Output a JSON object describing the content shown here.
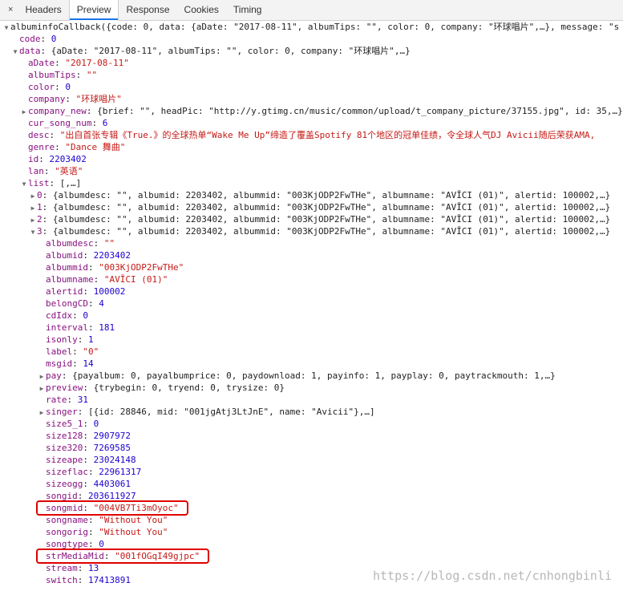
{
  "tabs": {
    "close": "×",
    "items": [
      "Headers",
      "Preview",
      "Response",
      "Cookies",
      "Timing"
    ],
    "active": "Preview"
  },
  "tree": [
    {
      "indent": 0,
      "t": "open",
      "k": "albuminfoCallback",
      "sep": "(",
      "v": "{code: 0, data: {aDate: \"2017-08-11\", albumTips: \"\", color: 0, company: \"环球唱片\",…}, message: \"s",
      "ty": "plain"
    },
    {
      "indent": 1,
      "t": "leaf",
      "k": "code",
      "sep": ": ",
      "v": "0",
      "ty": "num"
    },
    {
      "indent": 1,
      "t": "open",
      "k": "data",
      "sep": ": ",
      "v": "{aDate: \"2017-08-11\", albumTips: \"\", color: 0, company: \"环球唱片\",…}",
      "ty": "plain"
    },
    {
      "indent": 2,
      "t": "leaf",
      "k": "aDate",
      "sep": ": ",
      "v": "\"2017-08-11\"",
      "ty": "str"
    },
    {
      "indent": 2,
      "t": "leaf",
      "k": "albumTips",
      "sep": ": ",
      "v": "\"\"",
      "ty": "str"
    },
    {
      "indent": 2,
      "t": "leaf",
      "k": "color",
      "sep": ": ",
      "v": "0",
      "ty": "num"
    },
    {
      "indent": 2,
      "t": "leaf",
      "k": "company",
      "sep": ": ",
      "v": "\"环球唱片\"",
      "ty": "str"
    },
    {
      "indent": 2,
      "t": "closed",
      "k": "company_new",
      "sep": ": ",
      "v": "{brief: \"\", headPic: \"http://y.gtimg.cn/music/common/upload/t_company_picture/37155.jpg\", id: 35,…}",
      "ty": "plain"
    },
    {
      "indent": 2,
      "t": "leaf",
      "k": "cur_song_num",
      "sep": ": ",
      "v": "6",
      "ty": "num"
    },
    {
      "indent": 2,
      "t": "leaf",
      "k": "desc",
      "sep": ": ",
      "v": "\"出自首张专辑《True.》的全球热单“Wake Me Up”缔造了覆盖Spotify 81个地区的冠单佳绩，令全球人气DJ Avicii随后荣获AMA,",
      "ty": "str"
    },
    {
      "indent": 2,
      "t": "leaf",
      "k": "genre",
      "sep": ": ",
      "v": "\"Dance 舞曲\"",
      "ty": "str"
    },
    {
      "indent": 2,
      "t": "leaf",
      "k": "id",
      "sep": ": ",
      "v": "2203402",
      "ty": "num"
    },
    {
      "indent": 2,
      "t": "leaf",
      "k": "lan",
      "sep": ": ",
      "v": "\"英语\"",
      "ty": "str"
    },
    {
      "indent": 2,
      "t": "open",
      "k": "list",
      "sep": ": ",
      "v": "[,…]",
      "ty": "plain"
    },
    {
      "indent": 3,
      "t": "closed",
      "k": "0",
      "sep": ": ",
      "v": "{albumdesc: \"\", albumid: 2203402, albummid: \"003KjODP2FwTHe\", albumname: \"AVĪCI (01)\", alertid: 100002,…}",
      "ty": "plain"
    },
    {
      "indent": 3,
      "t": "closed",
      "k": "1",
      "sep": ": ",
      "v": "{albumdesc: \"\", albumid: 2203402, albummid: \"003KjODP2FwTHe\", albumname: \"AVĪCI (01)\", alertid: 100002,…}",
      "ty": "plain"
    },
    {
      "indent": 3,
      "t": "closed",
      "k": "2",
      "sep": ": ",
      "v": "{albumdesc: \"\", albumid: 2203402, albummid: \"003KjODP2FwTHe\", albumname: \"AVĪCI (01)\", alertid: 100002,…}",
      "ty": "plain"
    },
    {
      "indent": 3,
      "t": "open",
      "k": "3",
      "sep": ": ",
      "v": "{albumdesc: \"\", albumid: 2203402, albummid: \"003KjODP2FwTHe\", albumname: \"AVĪCI (01)\", alertid: 100002,…}",
      "ty": "plain"
    },
    {
      "indent": 4,
      "t": "leaf",
      "k": "albumdesc",
      "sep": ": ",
      "v": "\"\"",
      "ty": "str"
    },
    {
      "indent": 4,
      "t": "leaf",
      "k": "albumid",
      "sep": ": ",
      "v": "2203402",
      "ty": "num"
    },
    {
      "indent": 4,
      "t": "leaf",
      "k": "albummid",
      "sep": ": ",
      "v": "\"003KjODP2FwTHe\"",
      "ty": "str"
    },
    {
      "indent": 4,
      "t": "leaf",
      "k": "albumname",
      "sep": ": ",
      "v": "\"AVĪCI (01)\"",
      "ty": "str"
    },
    {
      "indent": 4,
      "t": "leaf",
      "k": "alertid",
      "sep": ": ",
      "v": "100002",
      "ty": "num"
    },
    {
      "indent": 4,
      "t": "leaf",
      "k": "belongCD",
      "sep": ": ",
      "v": "4",
      "ty": "num"
    },
    {
      "indent": 4,
      "t": "leaf",
      "k": "cdIdx",
      "sep": ": ",
      "v": "0",
      "ty": "num"
    },
    {
      "indent": 4,
      "t": "leaf",
      "k": "interval",
      "sep": ": ",
      "v": "181",
      "ty": "num"
    },
    {
      "indent": 4,
      "t": "leaf",
      "k": "isonly",
      "sep": ": ",
      "v": "1",
      "ty": "num"
    },
    {
      "indent": 4,
      "t": "leaf",
      "k": "label",
      "sep": ": ",
      "v": "\"0\"",
      "ty": "str"
    },
    {
      "indent": 4,
      "t": "leaf",
      "k": "msgid",
      "sep": ": ",
      "v": "14",
      "ty": "num"
    },
    {
      "indent": 4,
      "t": "closed",
      "k": "pay",
      "sep": ": ",
      "v": "{payalbum: 0, payalbumprice: 0, paydownload: 1, payinfo: 1, payplay: 0, paytrackmouth: 1,…}",
      "ty": "plain"
    },
    {
      "indent": 4,
      "t": "closed",
      "k": "preview",
      "sep": ": ",
      "v": "{trybegin: 0, tryend: 0, trysize: 0}",
      "ty": "plain"
    },
    {
      "indent": 4,
      "t": "leaf",
      "k": "rate",
      "sep": ": ",
      "v": "31",
      "ty": "num"
    },
    {
      "indent": 4,
      "t": "closed",
      "k": "singer",
      "sep": ": ",
      "v": "[{id: 28846, mid: \"001jgAtj3LtJnE\", name: \"Avicii\"},…]",
      "ty": "plain"
    },
    {
      "indent": 4,
      "t": "leaf",
      "k": "size5_1",
      "sep": ": ",
      "v": "0",
      "ty": "num"
    },
    {
      "indent": 4,
      "t": "leaf",
      "k": "size128",
      "sep": ": ",
      "v": "2907972",
      "ty": "num"
    },
    {
      "indent": 4,
      "t": "leaf",
      "k": "size320",
      "sep": ": ",
      "v": "7269585",
      "ty": "num"
    },
    {
      "indent": 4,
      "t": "leaf",
      "k": "sizeape",
      "sep": ": ",
      "v": "23024148",
      "ty": "num"
    },
    {
      "indent": 4,
      "t": "leaf",
      "k": "sizeflac",
      "sep": ": ",
      "v": "22961317",
      "ty": "num"
    },
    {
      "indent": 4,
      "t": "leaf",
      "k": "sizeogg",
      "sep": ": ",
      "v": "4403061",
      "ty": "num"
    },
    {
      "indent": 4,
      "t": "leaf",
      "k": "songid",
      "sep": ": ",
      "v": "203611927",
      "ty": "num"
    },
    {
      "indent": 4,
      "t": "leaf",
      "k": "songmid",
      "sep": ": ",
      "v": "\"004VB7Ti3mOyoc\"",
      "ty": "str",
      "hl": true
    },
    {
      "indent": 4,
      "t": "leaf",
      "k": "songname",
      "sep": ": ",
      "v": "\"Without You\"",
      "ty": "str"
    },
    {
      "indent": 4,
      "t": "leaf",
      "k": "songorig",
      "sep": ": ",
      "v": "\"Without You\"",
      "ty": "str"
    },
    {
      "indent": 4,
      "t": "leaf",
      "k": "songtype",
      "sep": ": ",
      "v": "0",
      "ty": "num"
    },
    {
      "indent": 4,
      "t": "leaf",
      "k": "strMediaMid",
      "sep": ": ",
      "v": "\"001fOGqI49gjpc\"",
      "ty": "str",
      "hl": true
    },
    {
      "indent": 4,
      "t": "leaf",
      "k": "stream",
      "sep": ": ",
      "v": "13",
      "ty": "num"
    },
    {
      "indent": 4,
      "t": "leaf",
      "k": "switch",
      "sep": ": ",
      "v": "17413891",
      "ty": "num"
    }
  ],
  "watermark": "https://blog.csdn.net/cnhongbinli",
  "colors": {
    "key": "#881280",
    "number": "#1c00cf",
    "string": "#c41a16",
    "highlight": "#e00000",
    "active_tab": "#1a73e8"
  }
}
